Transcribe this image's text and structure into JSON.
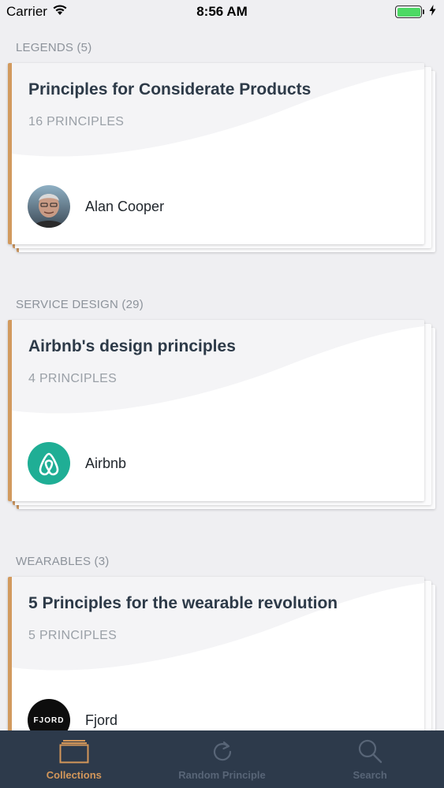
{
  "status_bar": {
    "carrier": "Carrier",
    "time": "8:56 AM"
  },
  "sections": [
    {
      "title": "LEGENDS (5)",
      "card": {
        "title": "Principles for Considerate Products",
        "count": "16 PRINCIPLES",
        "author": "Alan Cooper",
        "avatar": "person-photo"
      }
    },
    {
      "title": "SERVICE DESIGN (29)",
      "card": {
        "title": "Airbnb's design principles",
        "count": "4 PRINCIPLES",
        "author": "Airbnb",
        "avatar": "airbnb-logo"
      }
    },
    {
      "title": "WEARABLES (3)",
      "card": {
        "title": "5 Principles for the wearable revolution",
        "count": "5 PRINCIPLES",
        "author": "Fjord",
        "avatar": "fjord-logo",
        "avatar_text": "FJORD"
      }
    }
  ],
  "tab_bar": {
    "tabs": [
      {
        "label": "Collections",
        "icon": "collections-icon",
        "active": true
      },
      {
        "label": "Random Principle",
        "icon": "refresh-icon",
        "active": false
      },
      {
        "label": "Search",
        "icon": "search-icon",
        "active": false
      }
    ]
  },
  "colors": {
    "accent": "#d4975a",
    "tab_bar_bg": "#2d3a4b",
    "background": "#efeff2",
    "airbnb": "#1fae95",
    "battery": "#4cd964"
  }
}
